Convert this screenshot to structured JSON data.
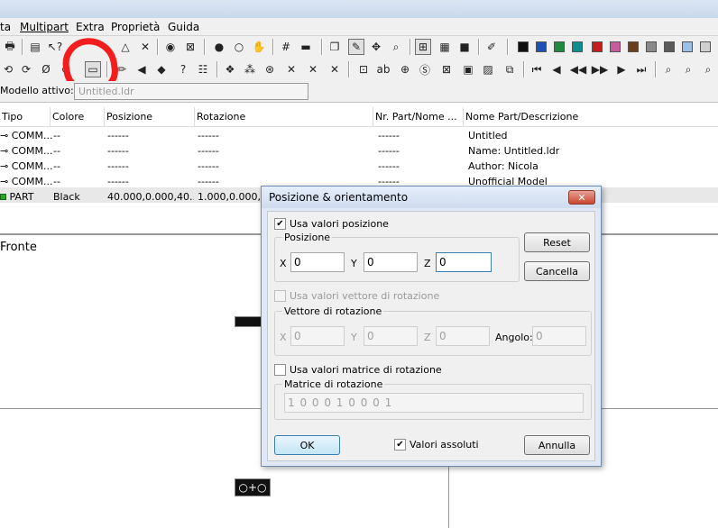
{
  "menu": {
    "items": [
      "ta",
      "Multipart",
      "Extra",
      "Proprietà",
      "Guida"
    ]
  },
  "model": {
    "label": "Modello attivo:",
    "value": "Untitled.ldr"
  },
  "table": {
    "columns": [
      "Tipo",
      "Colore",
      "Posizione",
      "Rotazione",
      "Nr. Part/Nome ...",
      "Nome Part/Descrizione"
    ],
    "rows": [
      [
        "COMM...",
        "--",
        "------",
        "------",
        "------",
        "Untitled"
      ],
      [
        "COMM...",
        "--",
        "------",
        "------",
        "------",
        "Name: Untitled.ldr"
      ],
      [
        "COMM...",
        "--",
        "------",
        "------",
        "------",
        "Author: Nicola"
      ],
      [
        "COMM...",
        "--",
        "------",
        "------",
        "------",
        "Unofficial Model"
      ],
      [
        "PART",
        "Black",
        "40.000,0.000,40...",
        "1.000,0.000,0.0",
        "",
        ""
      ]
    ]
  },
  "viewport": {
    "label": "Fronte"
  },
  "palette": {
    "colors": [
      "#101010",
      "#1d4fb5",
      "#1e8a3d",
      "#0b8e8e",
      "#c41e1e",
      "#c65c9c",
      "#6b3f1c",
      "#8a8a8a",
      "#5a5a5a",
      "#9bc0e6",
      "#cfcfcf"
    ]
  },
  "dialog": {
    "title": "Posizione & orientamento",
    "close_glyph": "✕",
    "use_position": {
      "label": "Usa valori posizione",
      "checked": true
    },
    "position_group": "Posizione",
    "x_label": "X",
    "y_label": "Y",
    "z_label": "Z",
    "pos_x": "0",
    "pos_y": "0",
    "pos_z": "0",
    "use_rotation_vector": {
      "label": "Usa valori vettore di rotazione",
      "checked": false
    },
    "rotation_group": "Vettore di rotazione",
    "rot_x": "0",
    "rot_y": "0",
    "rot_z": "0",
    "angle_label": "Angolo:",
    "angle": "0",
    "use_rotation_matrix": {
      "label": "Usa valori matrice di rotazione",
      "checked": false
    },
    "matrix_group": "Matrice di rotazione",
    "matrix_value": "1 0 0 0 1 0 0 0 1",
    "absolute": {
      "label": "Valori assoluti",
      "checked": true
    },
    "buttons": {
      "reset": "Reset",
      "delete": "Cancella",
      "ok": "OK",
      "cancel": "Annulla"
    }
  }
}
